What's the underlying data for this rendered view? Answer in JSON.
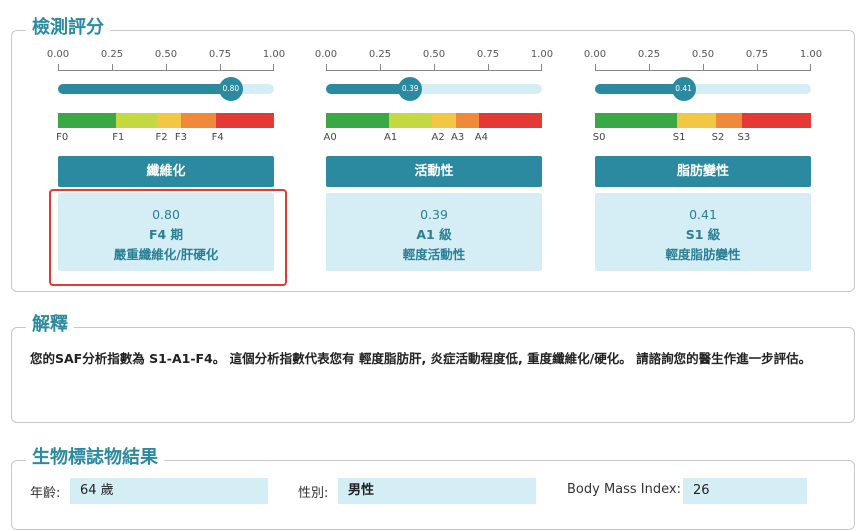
{
  "score_section": {
    "title": "檢測評分",
    "panels": [
      {
        "id": "fibrosis",
        "ticks": [
          "0.00",
          "0.25",
          "0.50",
          "0.75",
          "1.00"
        ],
        "value": 0.8,
        "knob_label": "0.80",
        "segments": [
          {
            "color": "#3aa845",
            "from": 0.0,
            "to": 0.27
          },
          {
            "color": "#c4d840",
            "from": 0.27,
            "to": 0.46
          },
          {
            "color": "#f2c744",
            "from": 0.46,
            "to": 0.57
          },
          {
            "color": "#ee8a3a",
            "from": 0.57,
            "to": 0.73
          },
          {
            "color": "#e53935",
            "from": 0.73,
            "to": 1.0
          }
        ],
        "stage_labels": [
          {
            "text": "F0",
            "at": 0.01
          },
          {
            "text": "F1",
            "at": 0.27
          },
          {
            "text": "F2",
            "at": 0.47
          },
          {
            "text": "F3",
            "at": 0.56
          },
          {
            "text": "F4",
            "at": 0.73
          }
        ],
        "header": "纖維化",
        "result_value": "0.80",
        "result_stage": "F4 期",
        "result_desc": "嚴重纖維化/肝硬化"
      },
      {
        "id": "activity",
        "ticks": [
          "0.00",
          "0.25",
          "0.50",
          "0.75",
          "1.00"
        ],
        "value": 0.39,
        "knob_label": "0.39",
        "segments": [
          {
            "color": "#3aa845",
            "from": 0.0,
            "to": 0.29
          },
          {
            "color": "#c4d840",
            "from": 0.29,
            "to": 0.49
          },
          {
            "color": "#f2c744",
            "from": 0.49,
            "to": 0.6
          },
          {
            "color": "#ee8a3a",
            "from": 0.6,
            "to": 0.71
          },
          {
            "color": "#e53935",
            "from": 0.71,
            "to": 1.0
          }
        ],
        "stage_labels": [
          {
            "text": "A0",
            "at": 0.01
          },
          {
            "text": "A1",
            "at": 0.29
          },
          {
            "text": "A2",
            "at": 0.51
          },
          {
            "text": "A3",
            "at": 0.6
          },
          {
            "text": "A4",
            "at": 0.71
          }
        ],
        "header": "活動性",
        "result_value": "0.39",
        "result_stage": "A1 級",
        "result_desc": "輕度活動性"
      },
      {
        "id": "steatosis",
        "ticks": [
          "0.00",
          "0.25",
          "0.50",
          "0.75",
          "1.00"
        ],
        "value": 0.41,
        "knob_label": "0.41",
        "segments": [
          {
            "color": "#3aa845",
            "from": 0.0,
            "to": 0.38
          },
          {
            "color": "#f2c744",
            "from": 0.38,
            "to": 0.56
          },
          {
            "color": "#ee8a3a",
            "from": 0.56,
            "to": 0.68
          },
          {
            "color": "#e53935",
            "from": 0.68,
            "to": 1.0
          }
        ],
        "stage_labels": [
          {
            "text": "S0",
            "at": 0.01
          },
          {
            "text": "S1",
            "at": 0.38
          },
          {
            "text": "S2",
            "at": 0.56
          },
          {
            "text": "S3",
            "at": 0.68
          }
        ],
        "header": "脂肪變性",
        "result_value": "0.41",
        "result_stage": "S1 級",
        "result_desc": "輕度脂肪變性"
      }
    ]
  },
  "explain_section": {
    "title": "解釋",
    "text": "您的SAF分析指數為 S1-A1-F4。 這個分析指數代表您有 輕度脂肪肝, 炎症活動程度低, 重度纖維化/硬化。 請諮詢您的醫生作進一步評估。"
  },
  "bio_section": {
    "title": "生物標誌物結果",
    "age_label": "年齡:",
    "age_value": "64 歲",
    "sex_label": "性別:",
    "sex_value": "男性",
    "bmi_label": "Body Mass Index:",
    "bmi_value": "26"
  },
  "colors": {
    "accent": "#2b8aa0",
    "light_accent": "#d5eef5",
    "highlight": "#e53935"
  }
}
